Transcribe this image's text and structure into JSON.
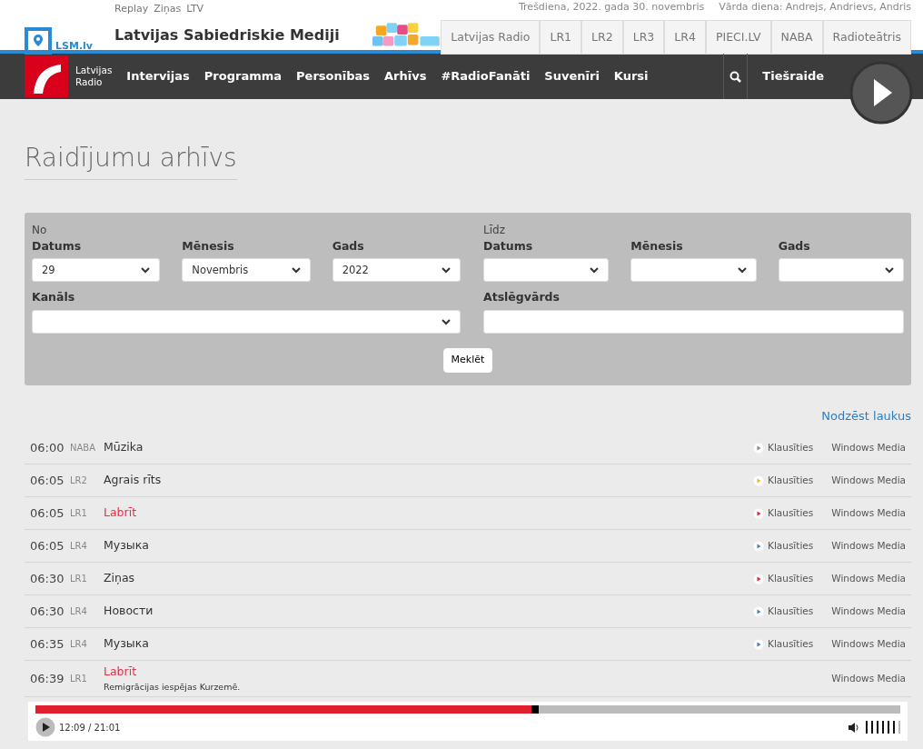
{
  "top_links": [
    "Replay",
    "Ziņas",
    "LTV"
  ],
  "logo_text": "LSM.lv",
  "site_title": "Latvijas Sabiedriskie Mediji",
  "date": "Trešdiena, 2022. gada 30. novembris",
  "name_day": "Vārda diena: Andrejs, Andrievs, Andris",
  "channel_tabs": [
    "Latvijas Radio",
    "LR1",
    "LR2",
    "LR3",
    "LR4",
    "PIECI.LV",
    "NABA",
    "Radioteātris"
  ],
  "brand": {
    "line1": "Latvijas",
    "line2": "Radio"
  },
  "nav": [
    "Intervijas",
    "Programma",
    "Personības",
    "Arhīvs",
    "#RadioFanāti",
    "Suvenīri",
    "Kursi"
  ],
  "live_label": "Tiešraide",
  "page_title": "Raidījumu arhīvs",
  "filter": {
    "from_label": "No",
    "to_label": "Līdz",
    "from": [
      {
        "label": "Datums",
        "value": "29"
      },
      {
        "label": "Mēnesis",
        "value": "Novembris"
      },
      {
        "label": "Gads",
        "value": "2022"
      }
    ],
    "to": [
      {
        "label": "Datums"
      },
      {
        "label": "Mēnesis"
      },
      {
        "label": "Gads"
      }
    ],
    "channel_label": "Kanāls",
    "keyword_label": "Atslēgvārds",
    "search_button": "Meklēt"
  },
  "clear_link": "Nodzēst laukus",
  "rows": [
    {
      "time": "06:00",
      "channel": "NABA",
      "title": "Mūzika",
      "highlighted": false,
      "listen": "Klausīties",
      "color": "#888888",
      "media": "Windows Media"
    },
    {
      "time": "06:05",
      "channel": "LR2",
      "title": "Agrais rīts",
      "highlighted": false,
      "listen": "Klausīties",
      "color": "#f0b429",
      "media": "Windows Media"
    },
    {
      "time": "06:05",
      "channel": "LR1",
      "title": "Labrīt",
      "highlighted": true,
      "listen": "Klausīties",
      "color": "#e02033",
      "media": "Windows Media"
    },
    {
      "time": "06:05",
      "channel": "LR4",
      "title": "Музыка",
      "highlighted": false,
      "listen": "Klausīties",
      "color": "#3f7fc4",
      "media": "Windows Media"
    },
    {
      "time": "06:30",
      "channel": "LR1",
      "title": "Ziņas",
      "highlighted": false,
      "listen": "Klausīties",
      "color": "#e02033",
      "media": "Windows Media"
    },
    {
      "time": "06:30",
      "channel": "LR4",
      "title": "Новости",
      "highlighted": false,
      "listen": "Klausīties",
      "color": "#3f7fc4",
      "media": "Windows Media"
    },
    {
      "time": "06:35",
      "channel": "LR4",
      "title": "Музыка",
      "highlighted": false,
      "listen": "Klausīties",
      "color": "#3f7fc4",
      "media": "Windows Media"
    },
    {
      "time": "06:39",
      "channel": "LR1",
      "title": "Labrīt",
      "subtitle": "Remigrācijas iespējas Kurzemē.",
      "highlighted": true,
      "media": "Windows Media"
    }
  ],
  "player": {
    "level": 0.575,
    "time": "12:09 / 21:01",
    "volume": {
      "level": 0.86
    }
  }
}
